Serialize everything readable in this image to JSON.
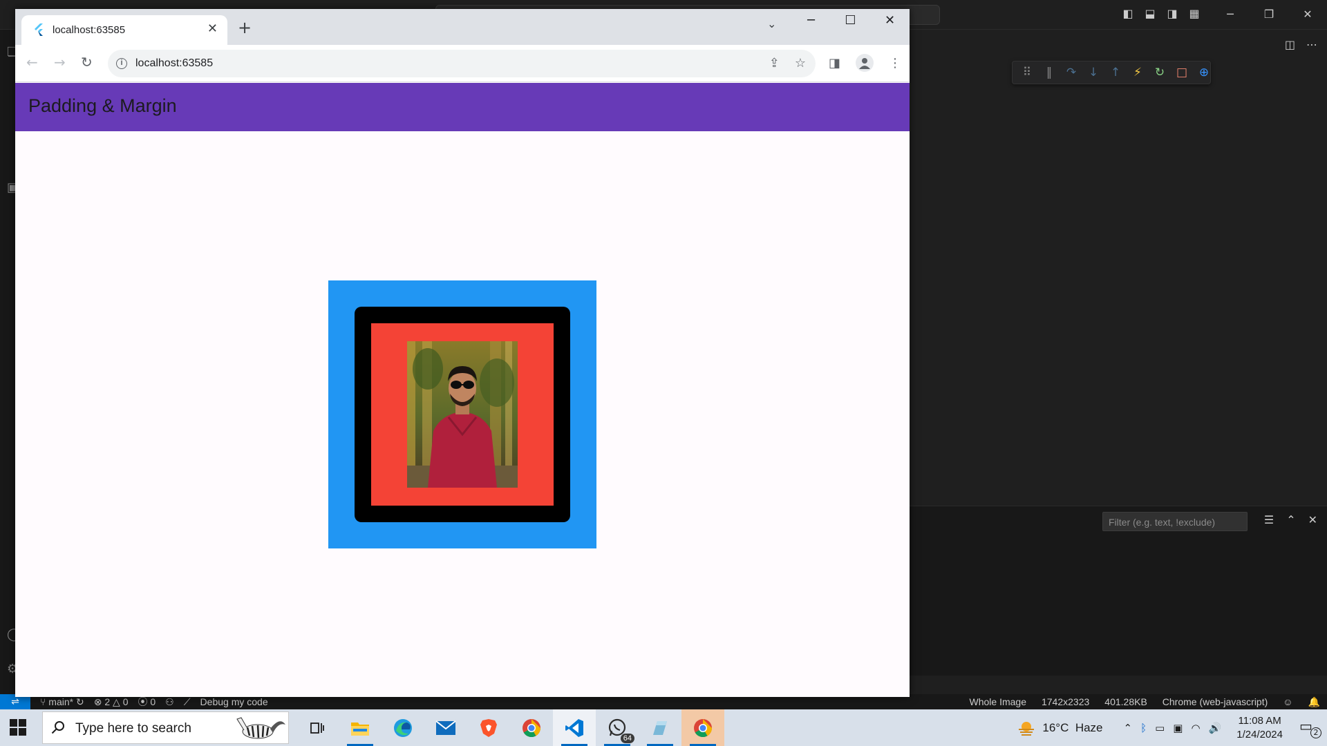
{
  "browser": {
    "tab_title": "localhost:63585",
    "url": "localhost:63585"
  },
  "app": {
    "title": "Padding & Margin",
    "colors": {
      "appbar": "#673ab7",
      "outer_container": "#2196f3",
      "middle_container": "#000000",
      "inner_container": "#f44336"
    }
  },
  "vscode": {
    "panel_filter_placeholder": "Filter (e.g. text, !exclude)",
    "status": {
      "branch": "main*",
      "errors": "2",
      "warnings": "0",
      "ports": "0",
      "debug": "Debug my code",
      "whole_image": "Whole Image",
      "dimensions": "1742x2323",
      "size": "401.28KB",
      "target": "Chrome (web-javascript)"
    }
  },
  "taskbar": {
    "search_placeholder": "Type here to search",
    "whatsapp_badge": "64",
    "weather": "16°C  Haze",
    "time": "11:08 AM",
    "date": "1/24/2024",
    "notification_count": "2"
  }
}
